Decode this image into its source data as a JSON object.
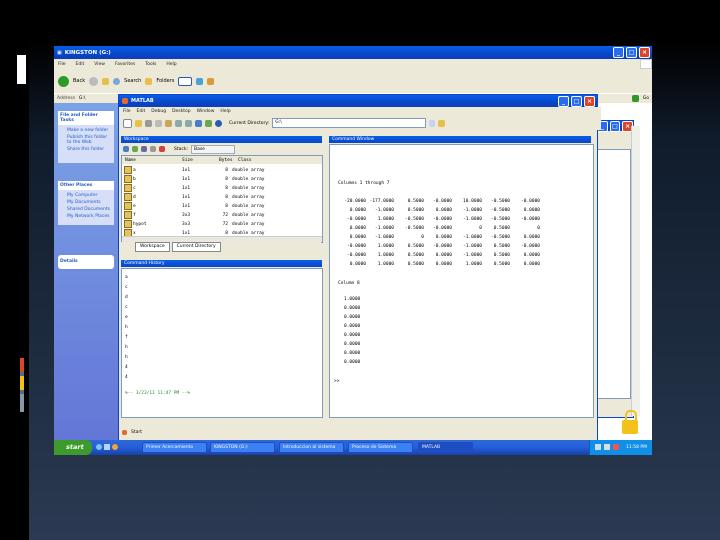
{
  "explorer": {
    "title": "KINGSTON (G:)",
    "menu": [
      "File",
      "Edit",
      "View",
      "Favorites",
      "Tools",
      "Help"
    ],
    "back_label": "Back",
    "search_label": "Search",
    "folders_label": "Folders",
    "address_label": "Address",
    "address_value": "G:\\",
    "tasks_header": "File and Folder Tasks",
    "tasks": [
      "Make a new folder",
      "Publish this folder to the Web",
      "Share this folder"
    ],
    "other_header": "Other Places",
    "other": [
      "My Computer",
      "My Documents",
      "Shared Documents",
      "My Network Places"
    ],
    "details_header": "Details",
    "go_label": "Go"
  },
  "matlab": {
    "title": "MATLAB",
    "menu": [
      "File",
      "Edit",
      "Debug",
      "Desktop",
      "Window",
      "Help"
    ],
    "current_dir_label": "Current Directory:",
    "current_dir_value": "G:\\",
    "workspace": {
      "title": "Workspace",
      "stack_label": "Stack:",
      "stack_value": "Base",
      "headers": [
        "Name",
        "Size",
        "Bytes",
        "Class"
      ],
      "rows": [
        {
          "name": "a",
          "size": "1x1",
          "bytes": "8",
          "cls": "double array"
        },
        {
          "name": "b",
          "size": "1x1",
          "bytes": "8",
          "cls": "double array"
        },
        {
          "name": "c",
          "size": "1x1",
          "bytes": "8",
          "cls": "double array"
        },
        {
          "name": "d",
          "size": "1x1",
          "bytes": "8",
          "cls": "double array"
        },
        {
          "name": "e",
          "size": "1x1",
          "bytes": "8",
          "cls": "double array"
        },
        {
          "name": "f",
          "size": "3x3",
          "bytes": "72",
          "cls": "double array"
        },
        {
          "name": "hypot",
          "size": "3x3",
          "bytes": "72",
          "cls": "double array"
        },
        {
          "name": "x",
          "size": "1x1",
          "bytes": "8",
          "cls": "double array"
        }
      ],
      "tabs": [
        "Workspace",
        "Current Directory"
      ]
    },
    "history": {
      "title": "Command History",
      "lines": [
        "a",
        "c",
        "d",
        "c",
        "e",
        "h",
        "f",
        "h",
        "h",
        "4",
        "4",
        "%-- 3/23/11 11:47 PM --%"
      ]
    },
    "command": {
      "title": "Command Window",
      "header1": "Columns 1 through 7",
      "rows": [
        [
          "-20.0000",
          "-177.0000",
          "0.5000",
          "-0.0000",
          "10.0000",
          "-0.5000",
          "-0.0000"
        ],
        [
          "0.0000",
          "-1.0000",
          "0.5000",
          "0.0000",
          "-1.0000",
          "-0.5000",
          "0.0000"
        ],
        [
          "-0.0000",
          "1.0000",
          "-0.5000",
          "-0.0000",
          "-1.0000",
          "-0.5000",
          "-0.0000"
        ],
        [
          "0.0000",
          "-1.0000",
          "-0.5000",
          "-0.0000",
          "0",
          "0.5000",
          "0"
        ],
        [
          "0.0000",
          "-1.0000",
          "0",
          "0.0000",
          "-1.0000",
          "-0.5000",
          "0.0000"
        ],
        [
          "-0.0000",
          "1.0000",
          "0.5000",
          "-0.0000",
          "-1.0000",
          "0.5000",
          "-0.0000"
        ],
        [
          "-0.0000",
          "1.0000",
          "0.5000",
          "0.0000",
          "-1.0000",
          "0.5000",
          "0.0000"
        ],
        [
          "0.0000",
          "1.0000",
          "0.5000",
          "0.0000",
          "1.0000",
          "0.5000",
          "0.0000"
        ]
      ],
      "header2": "Column 8",
      "col8": [
        "1.0000",
        "0.0000",
        "0.0000",
        "0.0000",
        "0.0000",
        "0.0000",
        "0.0000",
        "0.0000"
      ],
      "prompt": ">>"
    },
    "start_label": "Start"
  },
  "taskbar": {
    "start_label": "start",
    "items": [
      "Primer Acercamiento",
      "KINGSTON (G:)",
      "Introduccion al sistema",
      "Proceso de Sistema",
      "MATLAB"
    ],
    "clock": "11:58 PM"
  },
  "colors": {
    "xp_blue": "#0846c9",
    "start_green": "#3c9b2c",
    "accent_red": "#d9462c",
    "accent_yellow": "#f2c21b"
  }
}
